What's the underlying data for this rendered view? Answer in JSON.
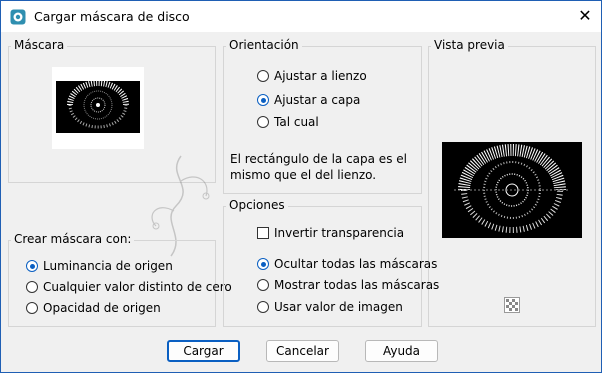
{
  "window": {
    "title": "Cargar máscara de disco",
    "close_glyph": "✕"
  },
  "mask_group": {
    "label": "Máscara"
  },
  "orientation": {
    "label": "Orientación",
    "options": [
      {
        "label": "Ajustar a lienzo",
        "selected": false
      },
      {
        "label": "Ajustar a capa",
        "selected": true
      },
      {
        "label": "Tal cual",
        "selected": false
      }
    ],
    "description": "El rectángulo de la capa es el mismo que el del lienzo."
  },
  "preview": {
    "label": "Vista previa",
    "icon": "transparency-checker-icon"
  },
  "create_mask": {
    "label": "Crear máscara con:",
    "options": [
      {
        "label": "Luminancia de origen",
        "selected": true
      },
      {
        "label": "Cualquier valor distinto de cero",
        "selected": false
      },
      {
        "label": "Opacidad de origen",
        "selected": false
      }
    ]
  },
  "options": {
    "label": "Opciones",
    "invert_label": "Invertir transparencia",
    "invert_checked": false,
    "radios": [
      {
        "label": "Ocultar todas las máscaras",
        "selected": true
      },
      {
        "label": "Mostrar todas las máscaras",
        "selected": false
      },
      {
        "label": "Usar valor de imagen",
        "selected": false
      }
    ]
  },
  "buttons": {
    "load": "Cargar",
    "cancel": "Cancelar",
    "help": "Ayuda"
  },
  "colors": {
    "accent": "#0a5fc2",
    "dialog_bg": "#f0f0f0",
    "group_border": "#d5d5d5"
  }
}
